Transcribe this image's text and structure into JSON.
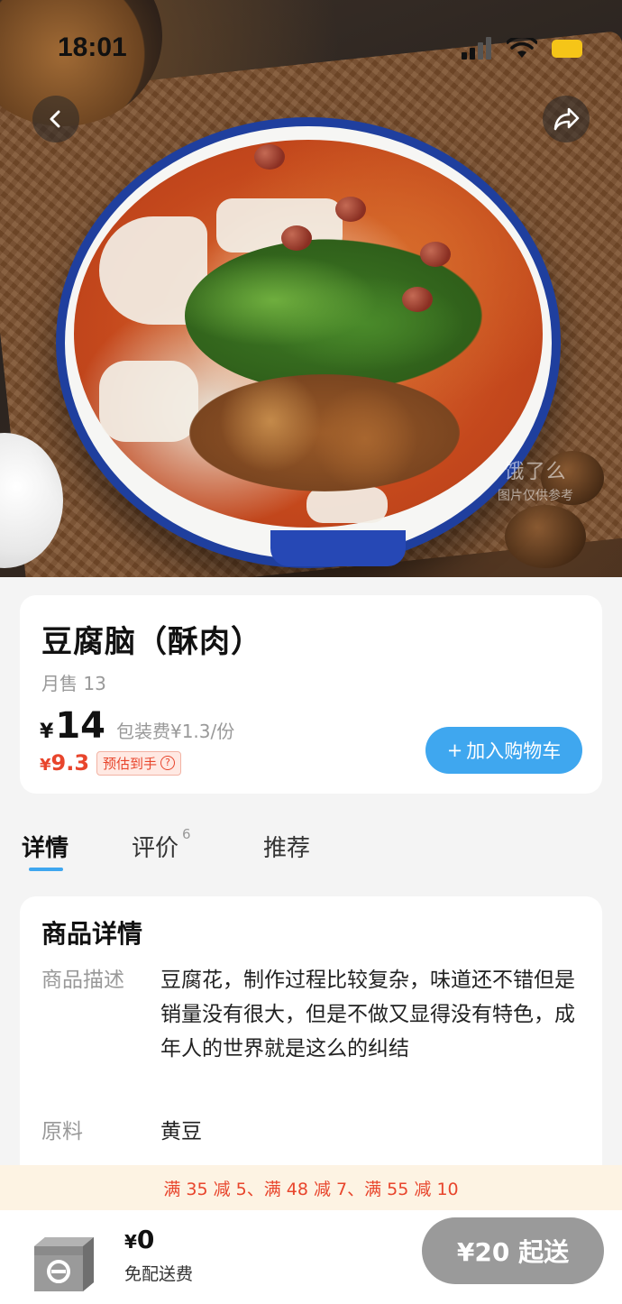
{
  "status_bar": {
    "time": "18:01"
  },
  "hero": {
    "watermark_logo": "饿了么",
    "watermark_note": "图片仅供参考"
  },
  "product": {
    "name": "豆腐脑（酥肉）",
    "monthly_sales": "月售 13",
    "currency": "¥",
    "price": "14",
    "packaging_fee": "包装费¥1.3/份",
    "estimated_currency": "¥",
    "estimated_price": "9.3",
    "estimated_label": "预估到手",
    "add_to_cart_label": "加入购物车",
    "accent_color": "#3fa7ef",
    "price_color": "#e8452c"
  },
  "tabs": [
    {
      "label": "详情",
      "active": true
    },
    {
      "label": "评价",
      "count": "6"
    },
    {
      "label": "推荐"
    }
  ],
  "details": {
    "title": "商品详情",
    "description_label": "商品描述",
    "description": "豆腐花，制作过程比较复杂，味道还不错但是销量没有很大，但是不做又显得没有特色，成年人的世界就是这么的纠结",
    "ingredient_label": "原料",
    "ingredient": "黄豆"
  },
  "promo": {
    "text": "满 35 减 5、满 48 减 7、满 55 减 10"
  },
  "bottom_bar": {
    "cart_currency": "¥",
    "cart_total": "0",
    "delivery_fee": "免配送费",
    "min_order": "¥20 起送"
  }
}
